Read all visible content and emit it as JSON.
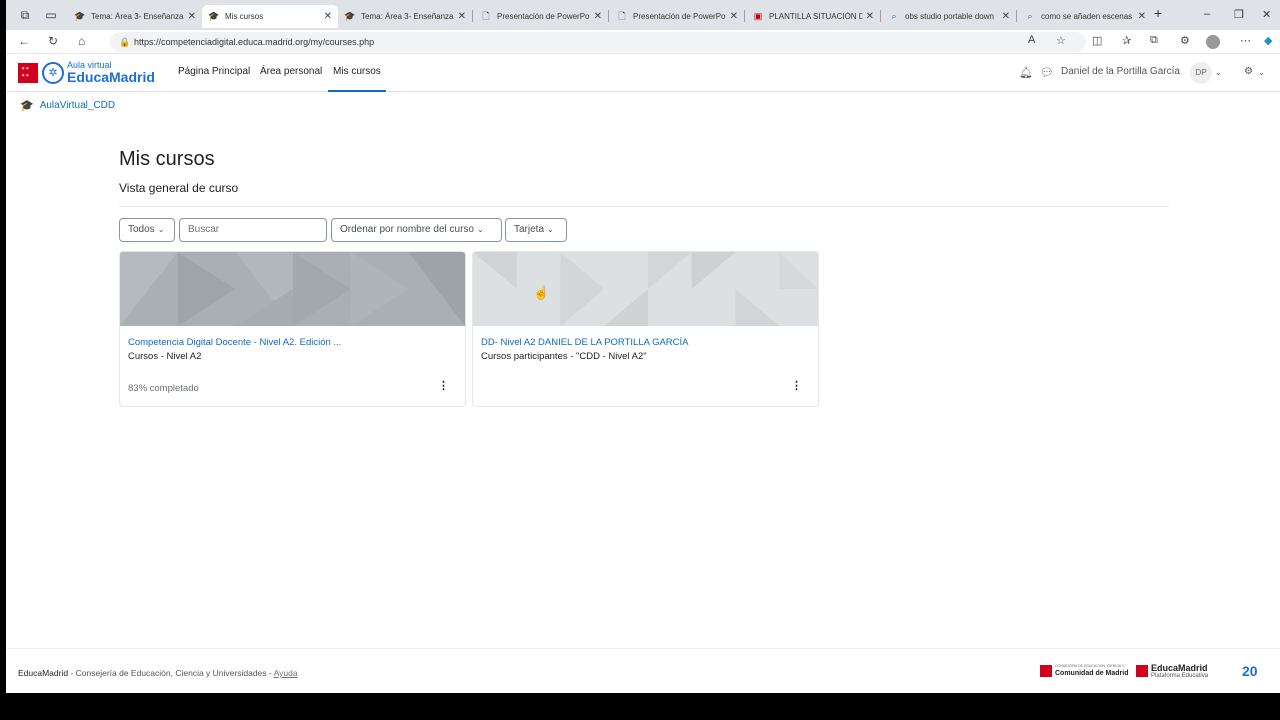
{
  "browser": {
    "tabs": [
      {
        "label": "Tema: Área 3- Enseñanza",
        "icon": "graduation-cap-icon",
        "active": false
      },
      {
        "label": "Mis cursos",
        "icon": "graduation-cap-icon",
        "active": true
      },
      {
        "label": "Tema: Área 3- Enseñanza",
        "icon": "graduation-cap-icon",
        "active": false
      },
      {
        "label": "Presentación de PowerPo",
        "icon": "document-icon",
        "active": false
      },
      {
        "label": "Presentación de PowerPo",
        "icon": "document-icon",
        "active": false
      },
      {
        "label": "PLANTILLA SITUACIÓN D",
        "icon": "pdf-icon",
        "active": false
      },
      {
        "label": "obs studio portable down",
        "icon": "search-icon",
        "active": false
      },
      {
        "label": "como se añaden escenas",
        "icon": "search-icon",
        "active": false
      }
    ],
    "url": "https://competenciadigital.educa.madrid.org/my/courses.php"
  },
  "site": {
    "logo_small": "Aula virtual",
    "logo_big": "EducaMadrid",
    "nav": [
      "Página Principal",
      "Área personal",
      "Mis cursos"
    ],
    "user_name": "Daniel de la Portilla García",
    "user_initials": "DP"
  },
  "breadcrumb": "AulaVirtual_CDD",
  "page": {
    "title": "Mis cursos",
    "subtitle": "Vista general de curso",
    "filters": {
      "grouping": "Todos",
      "search_placeholder": "Buscar",
      "sort": "Ordenar por nombre del curso",
      "view": "Tarjeta"
    }
  },
  "courses": [
    {
      "title": "Competencia Digital Docente - Nivel A2. Edición ...",
      "category": "Cursos - Nivel A2",
      "progress_text": "83% completado",
      "progress": 83
    },
    {
      "title": "DD- Nivel A2 DANIEL DE LA PORTILLA GARCÍA",
      "category": "Cursos participantes - \"CDD - Nivel A2\"",
      "progress_text": "",
      "progress": null
    }
  ],
  "footer": {
    "brand": "EducaMadrid",
    "text": " - Consejería de Educación, Ciencia y Universidades - ",
    "help": "Ayuda",
    "logo1_small": "CONSEJERÍA DE EDUCACIÓN, CIENCIA Y UNIVERSIDADES",
    "logo1_big": "Comunidad de Madrid",
    "logo2_big": "EducaMadrid",
    "logo2_small": "Plataforma Educativa",
    "anniversary": "20"
  },
  "colors": {
    "accent": "#0f6cbf",
    "brand_red": "#d2001f"
  }
}
